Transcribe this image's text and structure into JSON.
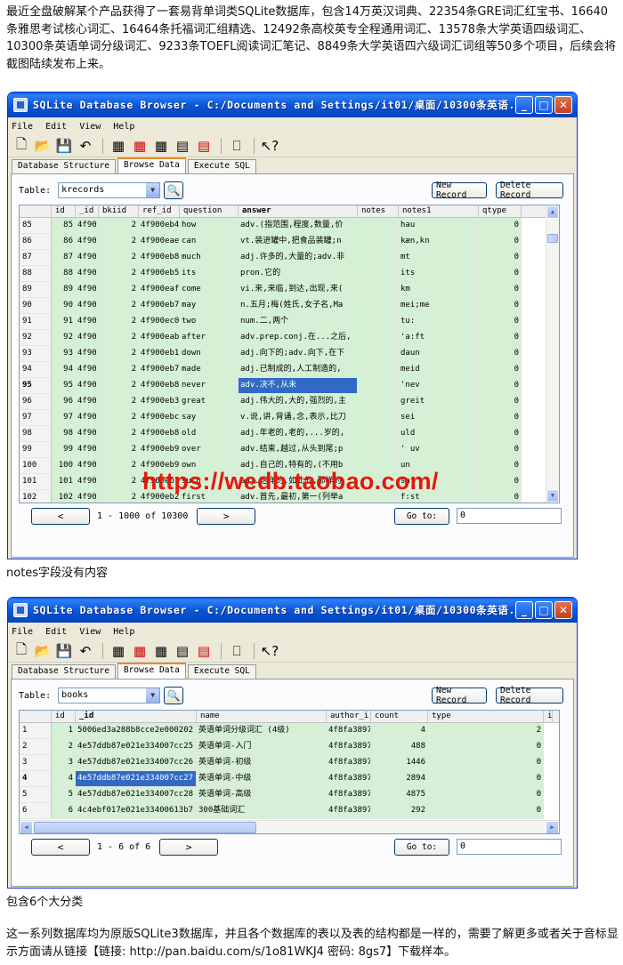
{
  "intro_text": "最近全盘破解某个产品获得了一套易背单词类SQLite数据库，包含14万英汉词典、22354条GRE词汇红宝书、16640条雅思考试核心词汇、16464条托福词汇组精选、12492条高校英专全程通用词汇、13578条大学英语四级词汇、10300条英语单词分级词汇、9233条TOEFL阅读词汇笔记、8849条大学英语四六级词汇词组等50多个项目，后续会将截图陆续发布上来。",
  "caption1": "notes字段没有内容",
  "caption2": "包含6个大分类",
  "footer_text": "这一系列数据库均为原版SQLite3数据库，并且各个数据库的表以及表的结构都是一样的，需要了解更多或者关于音标显示方面请从链接【链接: http://pan.baidu.com/s/1o81WKJ4 密码: 8gs7】下载样本。",
  "watermark": "https://wedb.taobao.com/",
  "window1": {
    "title": "SQLite Database Browser - C:/Documents and Settings/it01/桌面/10300条英语...",
    "menu": [
      "File",
      "Edit",
      "View",
      "Help"
    ],
    "tabs": [
      "Database Structure",
      "Browse Data",
      "Execute SQL"
    ],
    "table_label": "Table:",
    "table_value": "krecords",
    "new_record": "New Record",
    "delete_record": "Delete Record",
    "columns": [
      "id",
      "_id",
      "bkiid",
      "ref_id",
      "question",
      "answer",
      "notes",
      "notes1",
      "qtype"
    ],
    "rows": [
      [
        "85",
        "85",
        "4f90:",
        "2",
        "4f900eb4:",
        "how",
        "adv.(指范围,程度,数量,价",
        "",
        "hau",
        "0"
      ],
      [
        "86",
        "86",
        "4f90:",
        "2",
        "4f900eae:",
        "can",
        "vt.装进罐中,把食品装罐;n",
        "",
        "kæn,kn",
        "0"
      ],
      [
        "87",
        "87",
        "4f90:",
        "2",
        "4f900eb8:",
        "much",
        "adj.许多的,大量的;adv.非",
        "",
        "mt",
        "0"
      ],
      [
        "88",
        "88",
        "4f90:",
        "2",
        "4f900eb5:",
        "its",
        "pron.它的",
        "",
        "its",
        "0"
      ],
      [
        "89",
        "89",
        "4f90:",
        "2",
        "4f900eaf:",
        "come",
        "vi.来,来临,到达,出现,来(",
        "",
        "km",
        "0"
      ],
      [
        "90",
        "90",
        "4f90:",
        "2",
        "4f900eb7:",
        "may",
        "n.五月;梅(姓氏,女子名,Ma",
        "",
        "mei;me",
        "0"
      ],
      [
        "91",
        "91",
        "4f90:",
        "2",
        "4f900ec0:",
        "two",
        "num.二,两个",
        "",
        "tu:",
        "0"
      ],
      [
        "92",
        "92",
        "4f90:",
        "2",
        "4f900eab:",
        "after",
        "adv.prep.conj.在...之后,",
        "",
        "'a:ft",
        "0"
      ],
      [
        "93",
        "93",
        "4f90:",
        "2",
        "4f900eb1:",
        "down",
        "adj.向下的;adv.向下,在下",
        "",
        "daun",
        "0"
      ],
      [
        "94",
        "94",
        "4f90:",
        "2",
        "4f900eb7:",
        "made",
        "adj.已制成的,人工制造的,",
        "",
        "meid",
        "0"
      ],
      [
        "95",
        "95",
        "4f90:",
        "2",
        "4f900eb8:",
        "never",
        "adv.决不,从未",
        "",
        "'nev",
        "0"
      ],
      [
        "96",
        "96",
        "4f90:",
        "2",
        "4f900eb3:",
        "great",
        "adj.伟大的,大的,强烈的,主",
        "",
        "greit",
        "0"
      ],
      [
        "97",
        "97",
        "4f90:",
        "2",
        "4f900ebc:",
        "say",
        "v.说,讲,背诵,念,表示,比刀",
        "",
        "sei",
        "0"
      ],
      [
        "98",
        "98",
        "4f90:",
        "2",
        "4f900eb8:",
        "old",
        "adj.年老的,老的,...岁的,",
        "",
        "uld",
        "0"
      ],
      [
        "99",
        "99",
        "4f90:",
        "2",
        "4f900eb9:",
        "over",
        "adv.结束,越过,从头到尾;p",
        "",
        "' uv",
        "0"
      ],
      [
        "100",
        "100",
        "4f90:",
        "2",
        "4f900eb9:",
        "own",
        "adj.自己的,特有的,(不用b",
        "",
        "un",
        "0"
      ],
      [
        "101",
        "101",
        "4f90:",
        "2",
        "4f900eb7:",
        "such",
        "adj.这样的,如此的,那样的",
        "",
        "sat",
        "0"
      ],
      [
        "102",
        "102",
        "4f90:",
        "2",
        "4f900eb2:",
        "first",
        "adv.首先,最初,第一(列举a",
        "",
        "f:st",
        "0"
      ]
    ],
    "selected_row": 10,
    "record_info": "1 - 1000 of 10300",
    "prev_label": "<",
    "next_label": ">",
    "goto_label": "Go to:",
    "goto_value": "0"
  },
  "window2": {
    "title": "SQLite Database Browser - C:/Documents and Settings/it01/桌面/10300条英语...",
    "menu": [
      "File",
      "Edit",
      "View",
      "Help"
    ],
    "tabs": [
      "Database Structure",
      "Browse Data",
      "Execute SQL"
    ],
    "table_label": "Table:",
    "table_value": "books",
    "new_record": "New Record",
    "delete_record": "Delete Record",
    "columns": [
      "id",
      "_id",
      "name",
      "author_i",
      "count",
      "type",
      "i"
    ],
    "rows": [
      [
        "1",
        "1",
        "5006ed3a288b8cce2e000202",
        "英语单词分级词汇 (4级)",
        "4f8fa3897",
        "4",
        "2"
      ],
      [
        "2",
        "2",
        "4e57ddb87e021e334007cc25",
        "英语单词-入门",
        "4f8fa3897",
        "488",
        "0"
      ],
      [
        "3",
        "3",
        "4e57ddb87e021e334007cc26",
        "英语单词-初级",
        "4f8fa3897",
        "1446",
        "0"
      ],
      [
        "4",
        "4",
        "4e57ddb87e021e334007cc27",
        "英语单词-中级",
        "4f8fa3897",
        "2894",
        "0"
      ],
      [
        "5",
        "5",
        "4e57ddb87e021e334007cc28",
        "英语单词-高级",
        "4f8fa3897",
        "4875",
        "0"
      ],
      [
        "6",
        "6",
        "4c4ebf017e021e33400613b7",
        "300基础词汇",
        "4f8fa3897",
        "292",
        "0"
      ]
    ],
    "selected_row": 3,
    "record_info": "1 - 6 of 6",
    "prev_label": "<",
    "next_label": ">",
    "goto_label": "Go to:",
    "goto_value": "0"
  }
}
